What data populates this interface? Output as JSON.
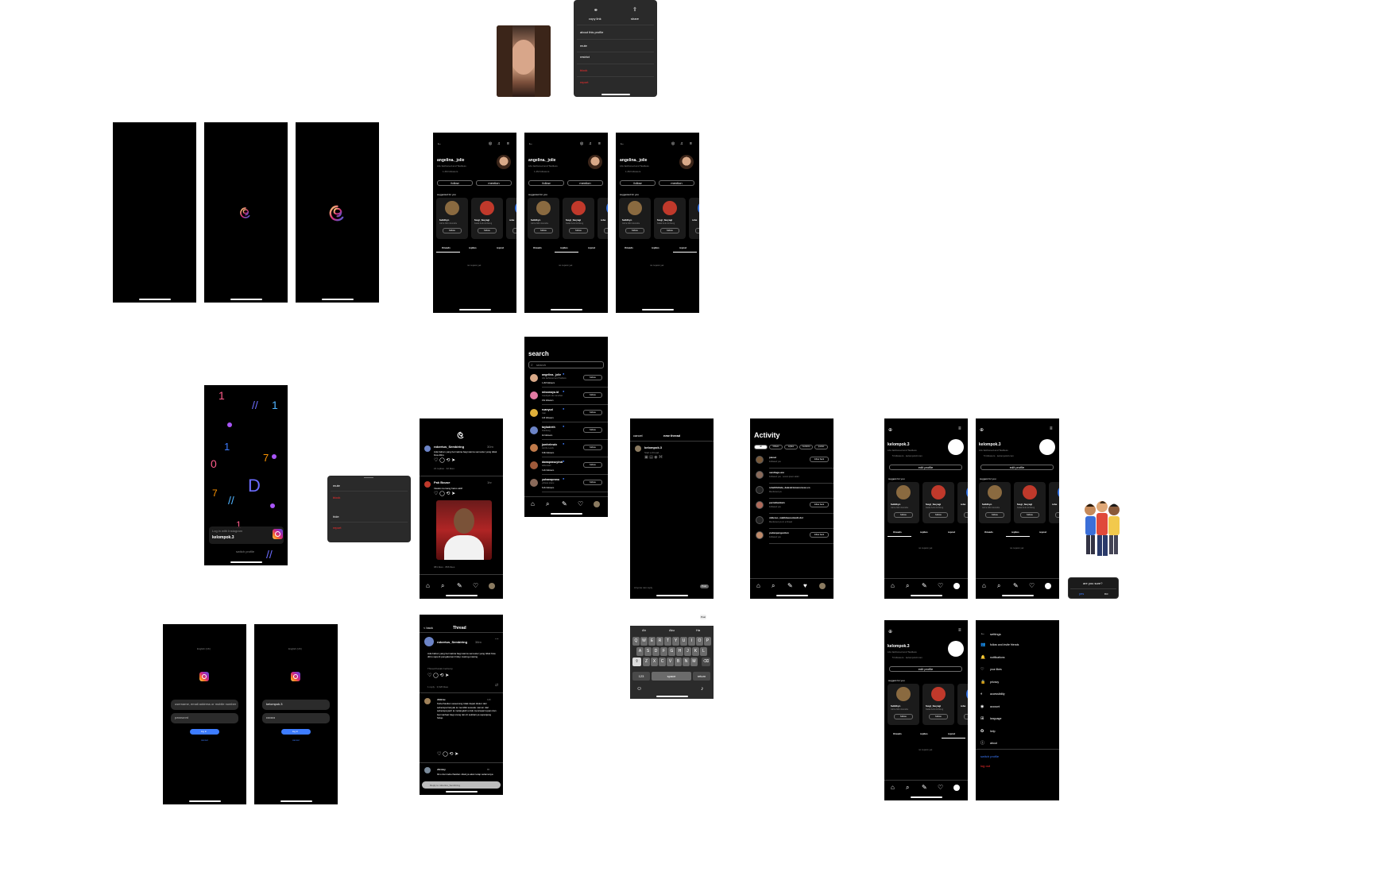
{
  "profile": {
    "username": "angelina._jolie",
    "bio": "Life fashioned and Tastiless",
    "followers": "1.2M followers",
    "follow": "follow",
    "mention": "mention",
    "suggested": "suggested for you",
    "suggestions": [
      {
        "name": "fadidkyo",
        "sub": "zahra bibir doorable",
        "button": "follow"
      },
      {
        "name": "fasgi_fauyagi",
        "sub": "Kalak Anik Ambiong",
        "button": "follow"
      },
      {
        "name": "rebe",
        "sub": "",
        "button": "follow"
      }
    ],
    "tabs": [
      "threads",
      "replies",
      "repost"
    ],
    "empty": "no repost yet"
  },
  "share_menu": {
    "copy_link": "copy link",
    "share": "share",
    "items": [
      "about this profile",
      "mute",
      "restrict",
      "block",
      "report"
    ]
  },
  "mute_menu": {
    "items": [
      "mute",
      "block",
      "hide",
      "report"
    ]
  },
  "search": {
    "title": "search",
    "placeholder": "search",
    "rows": [
      {
        "name": "angelina._jolie",
        "sub": "Life fashioned and Tastiless",
        "followers": "1.2M followers",
        "button": "follow"
      },
      {
        "name": "missmaya.id",
        "sub": "maudiyah oke ramahan",
        "followers": "15k followers",
        "button": "follow"
      },
      {
        "name": "ruanyud",
        "sub": "ruan",
        "followers": "143 followers",
        "button": "follow"
      },
      {
        "name": "tayladreth",
        "sub": "brainberg",
        "followers": "4k followers",
        "button": "follow"
      },
      {
        "name": "jumhelesdx",
        "sub": "Jumhe Lesdx",
        "followers": "6.8k followers",
        "button": "follow"
      },
      {
        "name": "dawaprasuyinal",
        "sub": "tahta kasir",
        "followers": "3.2k followers",
        "button": "follow"
      },
      {
        "name": "yuhanapranu",
        "sub": "yuhana pranu",
        "followers": "8.2k followers",
        "button": "follow"
      }
    ]
  },
  "feed": {
    "posts": [
      {
        "user": "robertus_Sembiring",
        "time": "30m",
        "text": "Ada bahan yang bermakna bagi warna semester yang tidak bisa ditiru",
        "stats": "21 replies · 32 likes"
      },
      {
        "user": "Pak Bouse",
        "time": "1hr",
        "text": "Intelek memang harus aktif",
        "stats": "981 likes · 896 likes"
      }
    ]
  },
  "new_thread": {
    "cancel": "cancel",
    "title": "new thread",
    "user": "kelompok.3",
    "hint": "Start a thread...",
    "anyone": "Anyone can reply",
    "post": "Post"
  },
  "keyboard": {
    "suggestions": [
      "Ah",
      "Aku",
      "Ha"
    ],
    "rows": [
      [
        "Q",
        "W",
        "E",
        "R",
        "T",
        "Y",
        "U",
        "I",
        "O",
        "P"
      ],
      [
        "A",
        "S",
        "D",
        "F",
        "G",
        "H",
        "J",
        "K",
        "L"
      ],
      [
        "Z",
        "X",
        "C",
        "V",
        "B",
        "N",
        "M"
      ]
    ],
    "num": "123",
    "space": "space",
    "return": "return",
    "post_label": "Post"
  },
  "activity": {
    "title": "Activity",
    "filters": [
      "all",
      "follows",
      "replies",
      "mentions",
      "quotes"
    ],
    "rows": [
      {
        "name": "jokowi",
        "text": "Followed you",
        "button": "follow back"
      },
      {
        "name": "sandiaga.uno",
        "text": "Followed you · Lorem ipsum dolor",
        "button": ""
      },
      {
        "name": "rebeltilcitata_daleskrionasi.meso.co",
        "text": "Mentioned you",
        "button": ""
      },
      {
        "name": "pernidiantiain",
        "text": "Followed you",
        "button": "follow back"
      },
      {
        "name": "vidiereo_nakiblasusolasih.dol",
        "text": "Mentioned you in a thread",
        "button": ""
      },
      {
        "name": "yudanpengestian",
        "text": "Followed you",
        "button": "follow back"
      }
    ]
  },
  "my_profile": {
    "username": "kelompok.3",
    "bio": "Life fashioned and Tastiless",
    "followers": "5 followers · kelompok3.com",
    "edit": "edit profile",
    "suggested": "suggest for you",
    "tabs": [
      "threads",
      "replies",
      "repost"
    ],
    "empty": "no repost yet"
  },
  "confirm": {
    "question": "are you sure?",
    "yes": "yes",
    "no": "no"
  },
  "thread_detail": {
    "back": "< back",
    "title": "Thread",
    "user": "robertus_Sembiring",
    "time": "38m",
    "text": "Ada bahan yang bermakna bagi warna semester yang tidak bisa ditiru seperti pengalaman hidup masing-masing",
    "translate": "Thread Kanak Cerita kp",
    "stats": "1 reply · 3,626 likes",
    "reply_user": "rifdirnu",
    "reply_time": "12h",
    "reply_text": "Keberhasilan seseorang tidak dapat diukur dari seberapa banyak ia memiliki sesuatu namun dari seberapa jauh ia melangkah untuk mencapai tujuan dan bermanfaat bagi orang lain di sekitarnya sepanjang hidup",
    "reply2_user": "dhrnisy",
    "reply2_time": "8h",
    "reply2_text": "Ilmu dan keberhasilan nilainya akan tetap selamanya",
    "reply_placeholder": "Reply to robertus_Sembiring"
  },
  "login": {
    "language": "English (UK)",
    "username_placeholder": "username, email address or mobile number",
    "password_placeholder": "password",
    "username_value": "kelompok.3",
    "password_value": "••••••••",
    "login_button": "log in",
    "cancel": "cancel"
  },
  "splash": {
    "login_label": "Log in with Instagram",
    "username": "kelompok.3",
    "switch": "switch profile"
  },
  "settings": {
    "title": "settings",
    "items": [
      "follow and invite friends",
      "notifications",
      "your likes",
      "privacy",
      "accessibility",
      "account",
      "language",
      "help",
      "about"
    ],
    "switch": "switch profile",
    "logout": "log out"
  },
  "colors": {
    "bg": "#000000",
    "accent": "#3d7cff",
    "danger": "#ff2d2d",
    "card": "#1b1b1b"
  }
}
